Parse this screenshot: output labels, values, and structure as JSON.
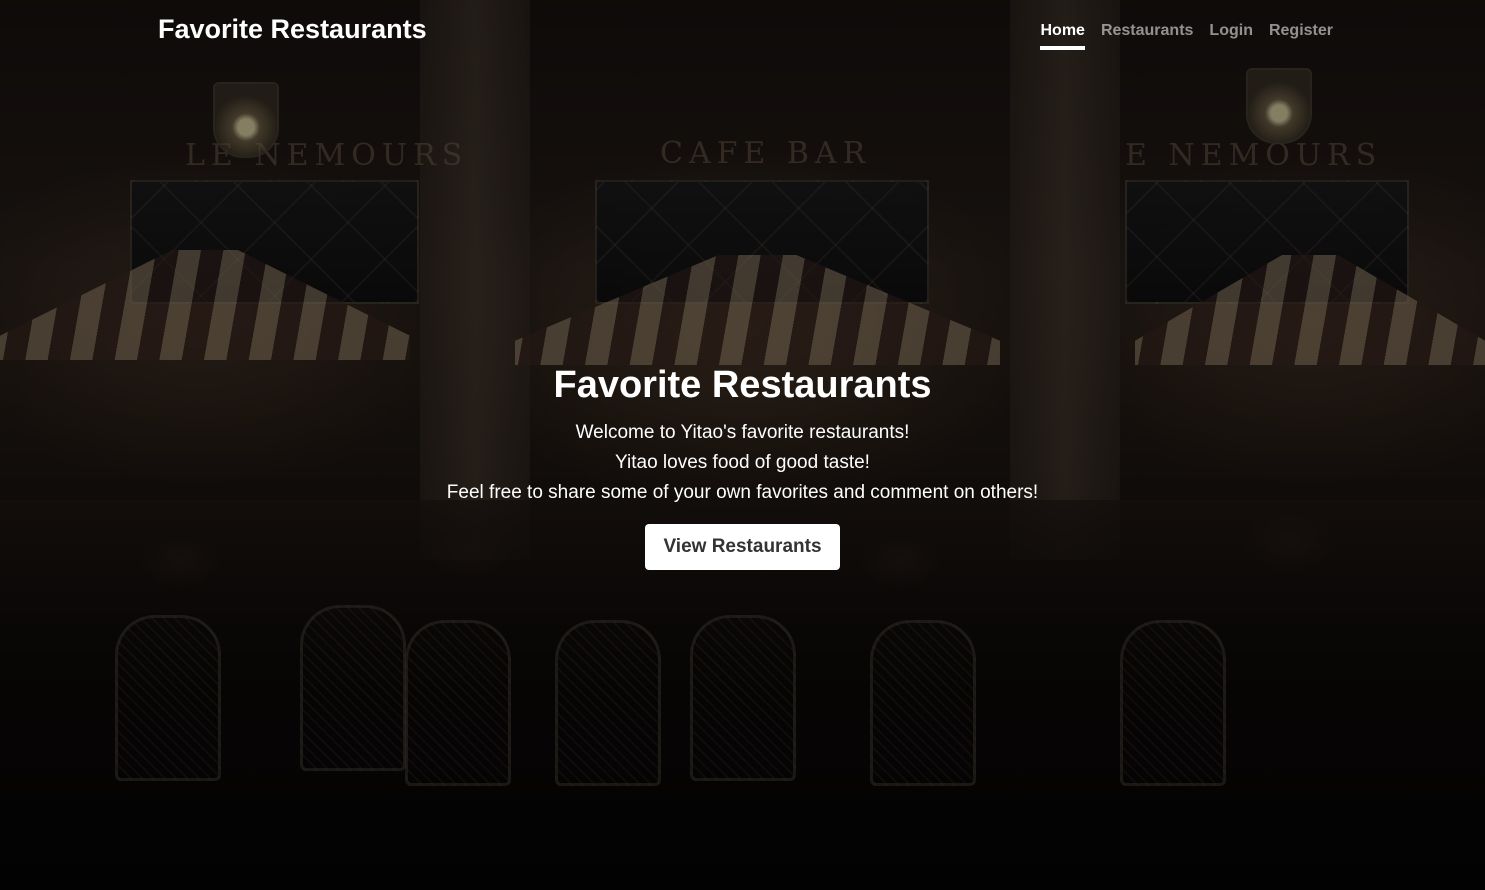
{
  "header": {
    "brand": "Favorite Restaurants",
    "nav": [
      {
        "label": "Home",
        "active": true
      },
      {
        "label": "Restaurants",
        "active": false
      },
      {
        "label": "Login",
        "active": false
      },
      {
        "label": "Register",
        "active": false
      }
    ]
  },
  "hero": {
    "title": "Favorite Restaurants",
    "lines": [
      "Welcome to Yitao's favorite restaurants!",
      "Yitao loves food of good taste!",
      "Feel free to share some of your own favorites and comment on others!"
    ],
    "button_label": "View Restaurants"
  },
  "background": {
    "signs": [
      "LE NEMOURS",
      "CAFE BAR",
      "E NEMOURS"
    ]
  },
  "colors": {
    "text": "#ffffff",
    "nav_inactive": "rgba(255,255,255,0.55)",
    "button_bg": "#ffffff",
    "button_text": "#333333"
  }
}
